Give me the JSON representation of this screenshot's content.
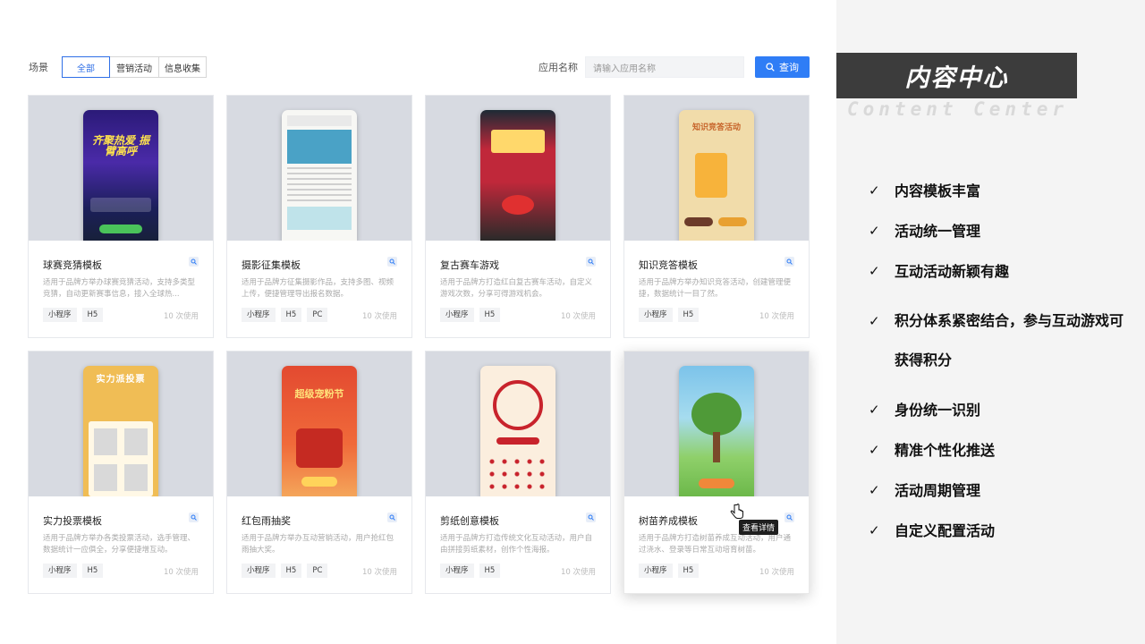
{
  "filter": {
    "label": "场景",
    "options": [
      {
        "label": "全部",
        "active": true
      },
      {
        "label": "营销活动",
        "active": false
      },
      {
        "label": "信息收集",
        "active": false
      }
    ]
  },
  "search": {
    "label": "应用名称",
    "placeholder": "请输入应用名称",
    "button": "查询"
  },
  "cards": [
    {
      "title": "球赛竞猜模板",
      "desc": "适用于品牌方举办球赛竞猜活动，支持多类型竞猜，自动更新赛事信息，接入全球热...",
      "tags": [
        "小程序",
        "H5"
      ],
      "usage": "10 次使用",
      "phone_title": "齐聚热爱 振臂高呼",
      "colors": [
        "#3b1f8a",
        "#1a1650"
      ]
    },
    {
      "title": "摄影征集模板",
      "desc": "适用于品牌方征集摄影作品，支持多图、视频上传，便捷管理导出报名数据。",
      "tags": [
        "小程序",
        "H5",
        "PC"
      ],
      "usage": "10 次使用",
      "phone_title": "",
      "colors": [
        "#f7f7f4",
        "#d9ecef"
      ]
    },
    {
      "title": "复古赛车游戏",
      "desc": "适用于品牌方打造红白复古赛车活动，自定义游戏次数，分享可得游戏机会。",
      "tags": [
        "小程序",
        "H5"
      ],
      "usage": "10 次使用",
      "phone_title": "",
      "colors": [
        "#b8283a",
        "#2a2a2a"
      ]
    },
    {
      "title": "知识竞答模板",
      "desc": "适用于品牌方举办知识竞答活动，创建管理便捷，数据统计一目了然。",
      "tags": [
        "小程序",
        "H5"
      ],
      "usage": "10 次使用",
      "phone_title": "知识竞答活动",
      "colors": [
        "#f3dfb0",
        "#eed59a"
      ]
    },
    {
      "title": "实力投票模板",
      "desc": "适用于品牌方举办各类投票活动，选手管理、数据统计一应俱全，分享便捷增互动。",
      "tags": [
        "小程序",
        "H5"
      ],
      "usage": "10 次使用",
      "phone_title": "实力派投票",
      "colors": [
        "#f2c05a",
        "#e8b24a"
      ]
    },
    {
      "title": "红包雨抽奖",
      "desc": "适用于品牌方举办互动营销活动，用户抢红包雨抽大奖。",
      "tags": [
        "小程序",
        "H5",
        "PC"
      ],
      "usage": "10 次使用",
      "phone_title": "超级宠粉节",
      "colors": [
        "#e8442f",
        "#f2683a"
      ]
    },
    {
      "title": "剪纸创意模板",
      "desc": "适用于品牌方打造传统文化互动活动，用户自由拼接剪纸素材，创作个性海报。",
      "tags": [
        "小程序",
        "H5"
      ],
      "usage": "10 次使用",
      "phone_title": "",
      "colors": [
        "#fbeede",
        "#f6e3cc"
      ]
    },
    {
      "title": "树苗养成模板",
      "desc": "适用于品牌方打造树苗养成互动活动，用户通过浇水、登录等日常互动培育树苗。",
      "tags": [
        "小程序",
        "H5"
      ],
      "usage": "10 次使用",
      "phone_title": "",
      "colors": [
        "#7cc2e8",
        "#8fd06a"
      ]
    }
  ],
  "tooltip": "查看详情",
  "side": {
    "title": "内容中心",
    "subtitle": "Content Center",
    "features": [
      "内容模板丰富",
      "活动统一管理",
      "互动活动新颖有趣",
      "积分体系紧密结合，参与互动游戏可获得积分",
      "身份统一识别",
      "精准个性化推送",
      "活动周期管理",
      "自定义配置活动"
    ]
  },
  "colors": {
    "accent": "#2f7df6",
    "panel": "#f4f4f4",
    "title_box": "#3c3c3c"
  }
}
